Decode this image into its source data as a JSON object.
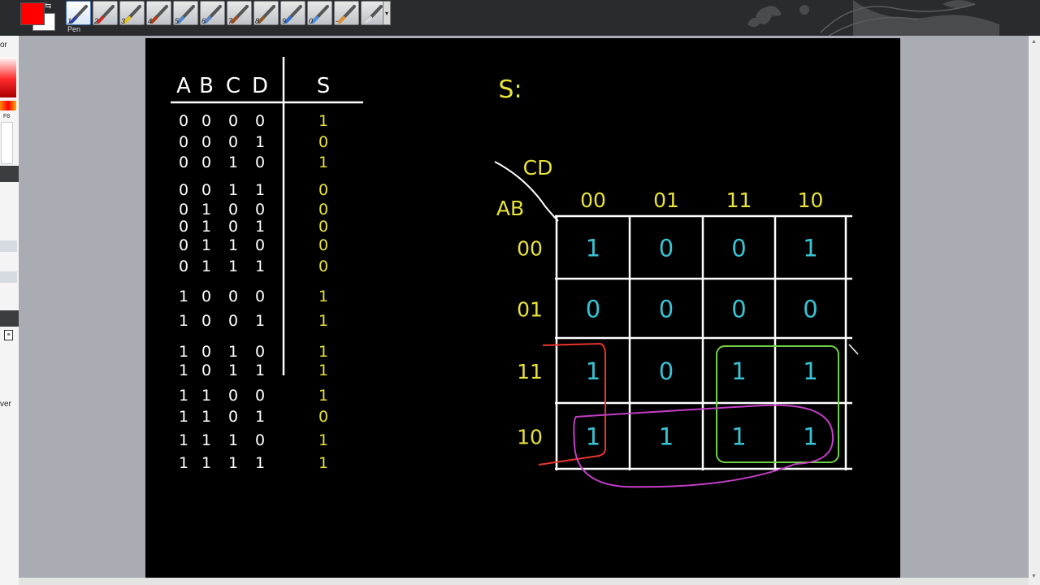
{
  "app": {
    "tool_label": "Pen",
    "tool_numbers": [
      "1",
      "2",
      "3",
      "4",
      "5",
      "6",
      "7",
      "8",
      "9",
      "0",
      "-"
    ],
    "tools": [
      "pen-tool",
      "red-marker-tool",
      "highlighter-tool",
      "brush-tool",
      "pencil-tool",
      "calligraphy-tool",
      "crayon-tool",
      "airbrush-tool",
      "shape-tool",
      "fill-tool",
      "smudge-tool",
      "eraser-tool"
    ],
    "left_panel": {
      "top_label": "or",
      "swatch_label": "F8",
      "bottom_label": "ver"
    },
    "colors": {
      "primary": "#ff0000",
      "secondary": "#ffffff",
      "board": "#000000"
    }
  },
  "truth_table": {
    "headers": [
      "A",
      "B",
      "C",
      "D",
      "S"
    ],
    "rows": [
      [
        "0",
        "0",
        "0",
        "0",
        "1"
      ],
      [
        "0",
        "0",
        "0",
        "1",
        "0"
      ],
      [
        "0",
        "0",
        "1",
        "0",
        "1"
      ],
      [
        "0",
        "0",
        "1",
        "1",
        "0"
      ],
      [
        "0",
        "1",
        "0",
        "0",
        "0"
      ],
      [
        "0",
        "1",
        "0",
        "1",
        "0"
      ],
      [
        "0",
        "1",
        "1",
        "0",
        "0"
      ],
      [
        "0",
        "1",
        "1",
        "1",
        "0"
      ],
      [
        "1",
        "0",
        "0",
        "0",
        "1"
      ],
      [
        "1",
        "0",
        "0",
        "1",
        "1"
      ],
      [
        "1",
        "0",
        "1",
        "0",
        "1"
      ],
      [
        "1",
        "0",
        "1",
        "1",
        "1"
      ],
      [
        "1",
        "1",
        "0",
        "0",
        "1"
      ],
      [
        "1",
        "1",
        "0",
        "1",
        "0"
      ],
      [
        "1",
        "1",
        "1",
        "0",
        "1"
      ],
      [
        "1",
        "1",
        "1",
        "1",
        "1"
      ]
    ]
  },
  "kmap": {
    "output_label": "S:",
    "col_var": "CD",
    "row_var": "AB",
    "col_headers": [
      "00",
      "01",
      "11",
      "10"
    ],
    "row_headers": [
      "00",
      "01",
      "11",
      "10"
    ],
    "cells": [
      [
        "1",
        "0",
        "0",
        "1"
      ],
      [
        "0",
        "0",
        "0",
        "0"
      ],
      [
        "1",
        "0",
        "1",
        "1"
      ],
      [
        "1",
        "1",
        "1",
        "1"
      ]
    ],
    "groups": [
      {
        "color": "#e8352d",
        "cells": "column 00, rows 11-10"
      },
      {
        "color": "#6ed044",
        "cells": "columns 11-10, rows 11-10"
      },
      {
        "color": "#c33ec6",
        "cells": "row 10, all columns"
      }
    ]
  }
}
